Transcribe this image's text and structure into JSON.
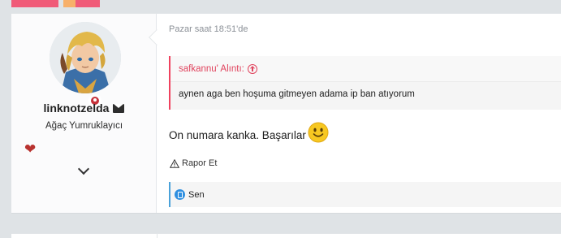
{
  "user": {
    "name": "linknotzelda",
    "title": "Ağaç Yumruklayıcı"
  },
  "post": {
    "timestamp": "Pazar saat 18:51'de",
    "quote": {
      "header": "safkannu' Alıntı:",
      "text": "aynen aga ben hoşuma gitmeyen adama ip ban atıyorum"
    },
    "message": "On numara kanka. Başarılar",
    "report_label": "Rapor Et",
    "likes_label": "Sen"
  },
  "colors": {
    "accent": "#f05a78",
    "quote_border": "#f0425e",
    "like_blue": "#2f8fe0",
    "heart": "#b8322f"
  }
}
